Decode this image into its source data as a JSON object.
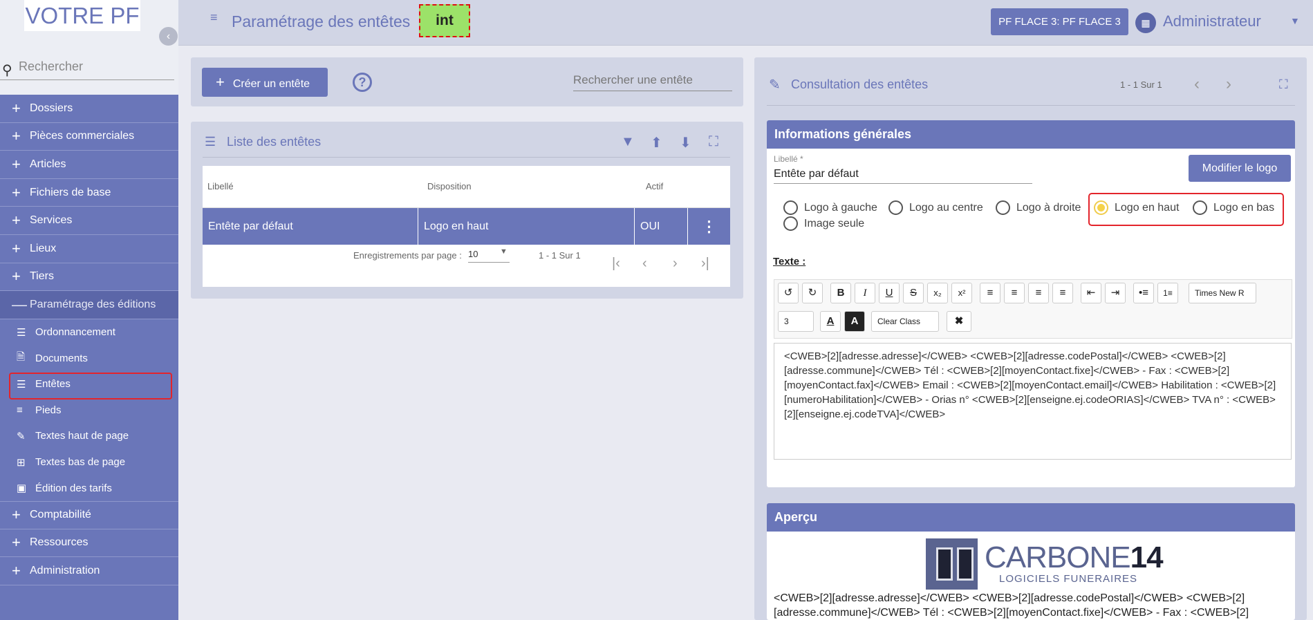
{
  "sidebar": {
    "logo": "VOTRE PF",
    "collapse_icon": "‹",
    "search_placeholder": "Rechercher",
    "menu": [
      {
        "label": "Dossiers"
      },
      {
        "label": "Pièces commerciales"
      },
      {
        "label": "Articles"
      },
      {
        "label": "Fichiers de base"
      },
      {
        "label": "Services"
      },
      {
        "label": "Lieux"
      },
      {
        "label": "Tiers"
      },
      {
        "label": "Paramétrage des éditions"
      }
    ],
    "submenu": [
      {
        "label": "Ordonnancement"
      },
      {
        "label": "Documents"
      },
      {
        "label": "Entêtes"
      },
      {
        "label": "Pieds"
      },
      {
        "label": "Textes haut de page"
      },
      {
        "label": "Textes bas de page"
      },
      {
        "label": "Édition des tarifs"
      }
    ],
    "menu_bottom": [
      {
        "label": "Comptabilité"
      },
      {
        "label": "Ressources"
      },
      {
        "label": "Administration"
      }
    ]
  },
  "header": {
    "title": "Paramétrage des entêtes",
    "env_badge": "int",
    "pf_button": "PF FLACE 3: PF FLACE 3",
    "user": "Administrateur"
  },
  "list_toolbar": {
    "create_button": "Créer un entête",
    "search_placeholder": "Rechercher une entête"
  },
  "list": {
    "title": "Liste des entêtes",
    "columns": [
      "Libellé",
      "Disposition",
      "Actif"
    ],
    "rows": [
      {
        "libelle": "Entête par défaut",
        "disposition": "Logo en haut",
        "actif": "OUI"
      }
    ],
    "per_page_label": "Enregistrements par page :",
    "per_page_value": "10",
    "range": "1 - 1 Sur 1"
  },
  "detail": {
    "title": "Consultation des entêtes",
    "range": "1 - 1 Sur 1",
    "general_title": "Informations générales",
    "libelle_label": "Libellé *",
    "libelle_value": "Entête par défaut",
    "modify_logo_button": "Modifier le logo",
    "radios": [
      {
        "label": "Logo à gauche",
        "selected": false
      },
      {
        "label": "Logo au centre",
        "selected": false
      },
      {
        "label": "Logo à droite",
        "selected": false
      },
      {
        "label": "Logo en haut",
        "selected": true
      },
      {
        "label": "Logo en bas",
        "selected": false
      },
      {
        "label": "Image seule",
        "selected": false
      }
    ],
    "texte_label": "Texte :",
    "font_select": "Times New R",
    "size_select": "3",
    "class_select": "Clear Class",
    "editor_text": "<CWEB>[2][adresse.adresse]</CWEB> <CWEB>[2][adresse.codePostal]</CWEB> <CWEB>[2][adresse.commune]</CWEB> Tél : <CWEB>[2][moyenContact.fixe]</CWEB> - Fax : <CWEB>[2][moyenContact.fax]</CWEB> Email : <CWEB>[2][moyenContact.email]</CWEB> Habilitation : <CWEB>[2][numeroHabilitation]</CWEB> - Orias n° <CWEB>[2][enseigne.ej.codeORIAS]</CWEB> TVA n° : <CWEB>[2][enseigne.ej.codeTVA]</CWEB>",
    "preview_title": "Aperçu",
    "preview_logo_brand": "CARBONE",
    "preview_logo_num": "14",
    "preview_logo_sub": "LOGICIELS FUNERAIRES",
    "preview_text": "<CWEB>[2][adresse.adresse]</CWEB> <CWEB>[2][adresse.codePostal]</CWEB> <CWEB>[2][adresse.commune]</CWEB> Tél : <CWEB>[2][moyenContact.fixe]</CWEB> - Fax : <CWEB>[2]"
  },
  "colors": {
    "primary": "#6a76b9",
    "highlight": "#e3242b",
    "env": "#9ce269"
  }
}
